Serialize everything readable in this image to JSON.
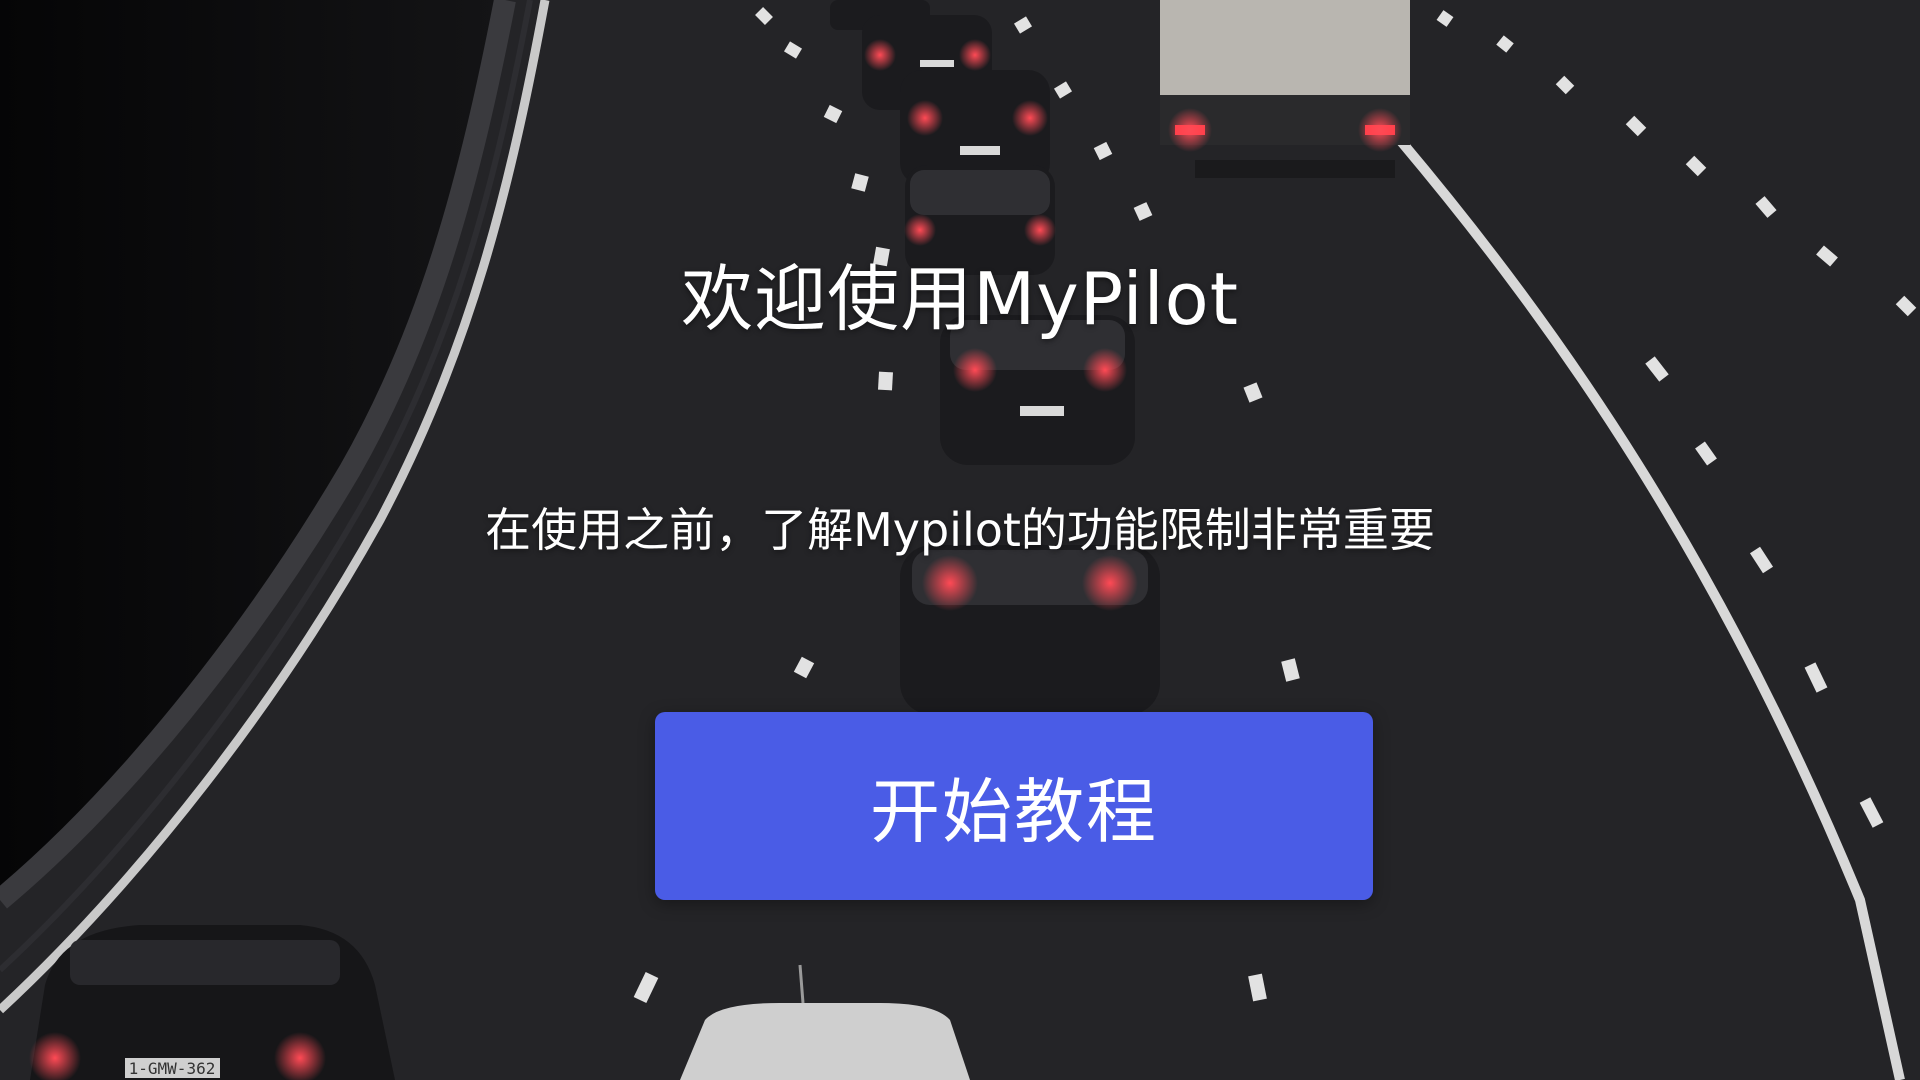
{
  "welcome": {
    "title": "欢迎使用MyPilot",
    "subtitle": "在使用之前，了解Mypilot的功能限制非常重要"
  },
  "actions": {
    "start_tutorial_label": "开始教程"
  },
  "background": {
    "plate_1": "1-GMW-362"
  },
  "colors": {
    "button": "#4a5ce6",
    "text": "#ffffff",
    "road": "#242427"
  }
}
